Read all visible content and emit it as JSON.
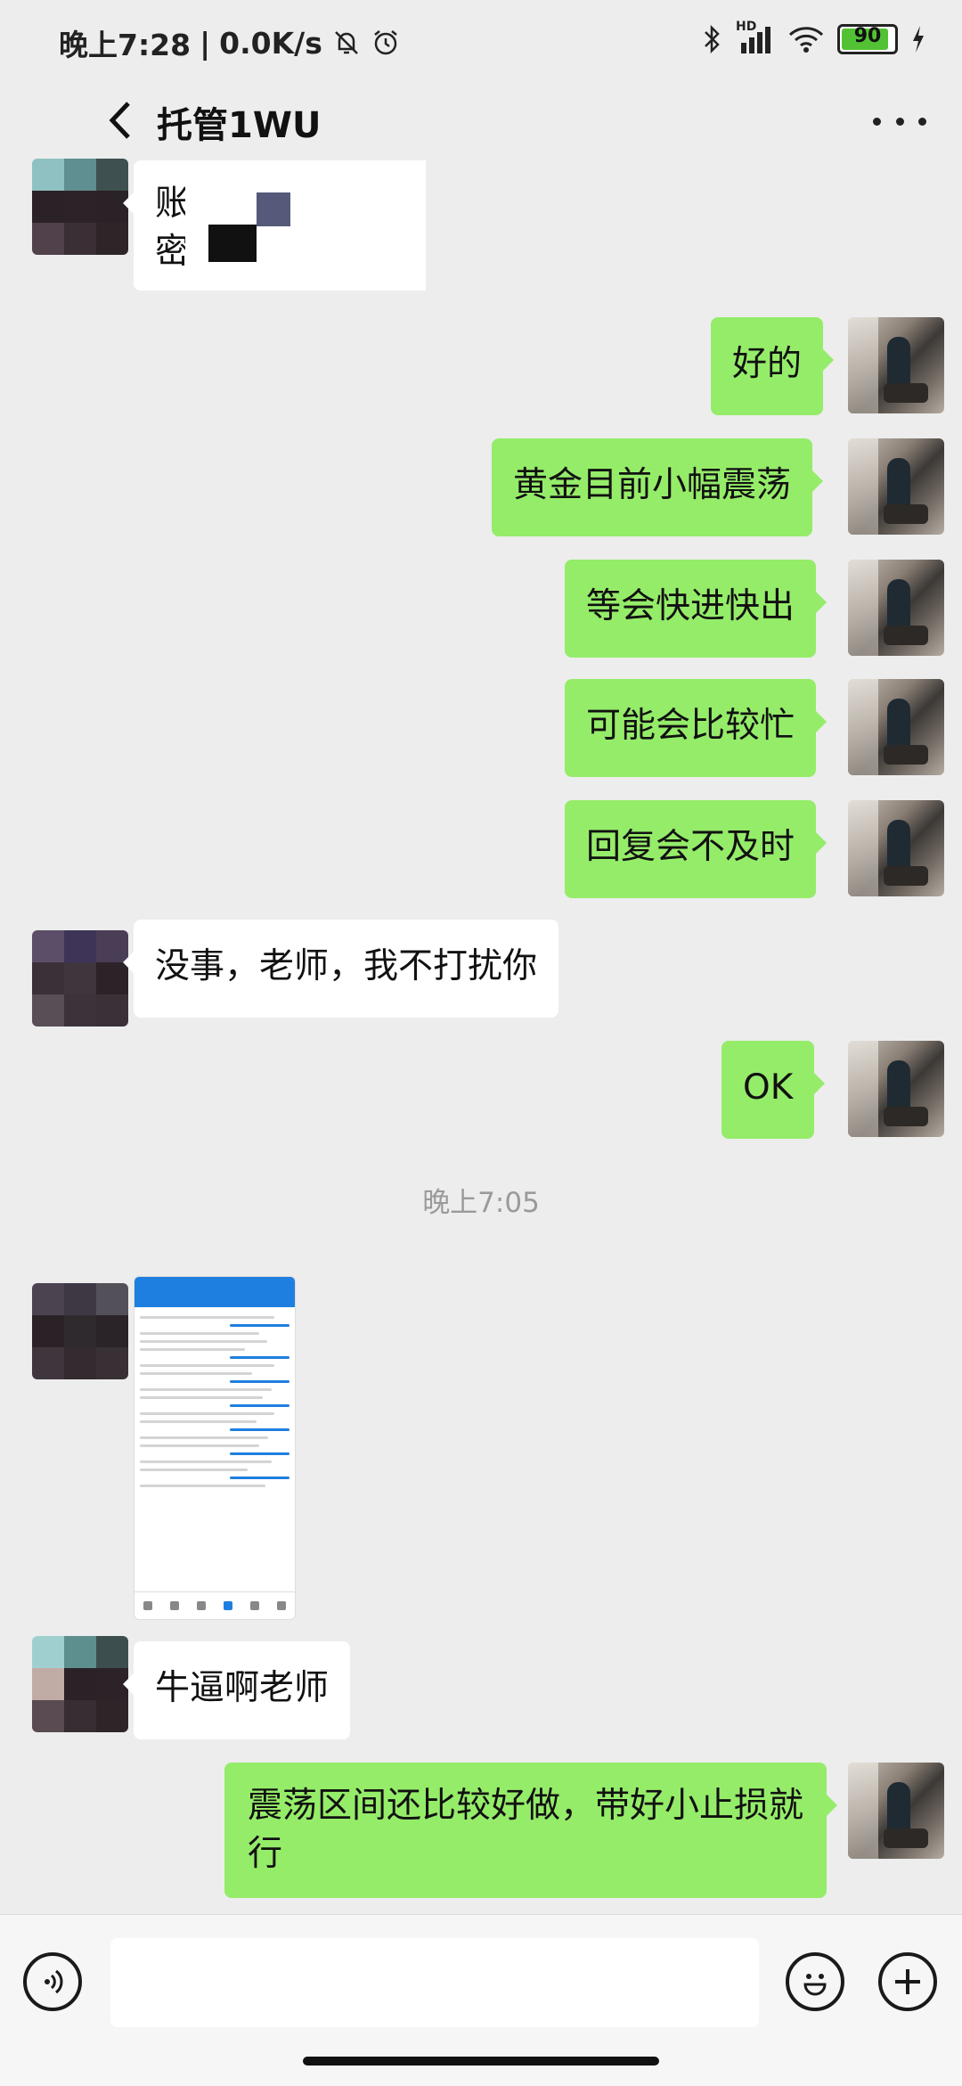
{
  "status_bar": {
    "time": "晚上7:28",
    "net_speed": "0.0K/s",
    "hd_label": "HD",
    "battery": "90",
    "battery_level_percent": 90
  },
  "title_bar": {
    "title": "托管1WU"
  },
  "messages": [
    {
      "side": "in",
      "type": "text",
      "lines": [
        "账户",
        "密码"
      ]
    },
    {
      "side": "out",
      "type": "text",
      "text": "好的"
    },
    {
      "side": "out",
      "type": "text",
      "text": "黄金目前小幅震荡"
    },
    {
      "side": "out",
      "type": "text",
      "text": "等会快进快出"
    },
    {
      "side": "out",
      "type": "text",
      "text": "可能会比较忙"
    },
    {
      "side": "out",
      "type": "text",
      "text": "回复会不及时"
    },
    {
      "side": "in",
      "type": "text",
      "text": "没事，老师，我不打扰你"
    },
    {
      "side": "out",
      "type": "text",
      "text": "OK"
    },
    {
      "type": "time",
      "text": "晚上7:05"
    },
    {
      "side": "in",
      "type": "image",
      "icon": "trading-screenshot"
    },
    {
      "side": "in",
      "type": "text",
      "text": "牛逼啊老师"
    },
    {
      "side": "out",
      "type": "text",
      "text": "震荡区间还比较好做，带好小止损就行"
    }
  ],
  "input_bar": {
    "value": "",
    "placeholder": ""
  },
  "colors": {
    "background": "#ededed",
    "outgoing_bubble": "#95ec69",
    "incoming_bubble": "#ffffff",
    "time_text": "#9a9a9a"
  },
  "icons": {
    "voice": "voice-icon",
    "emoji": "emoji-icon",
    "plus": "plus-icon",
    "more": "more-icon",
    "back": "back-icon"
  }
}
